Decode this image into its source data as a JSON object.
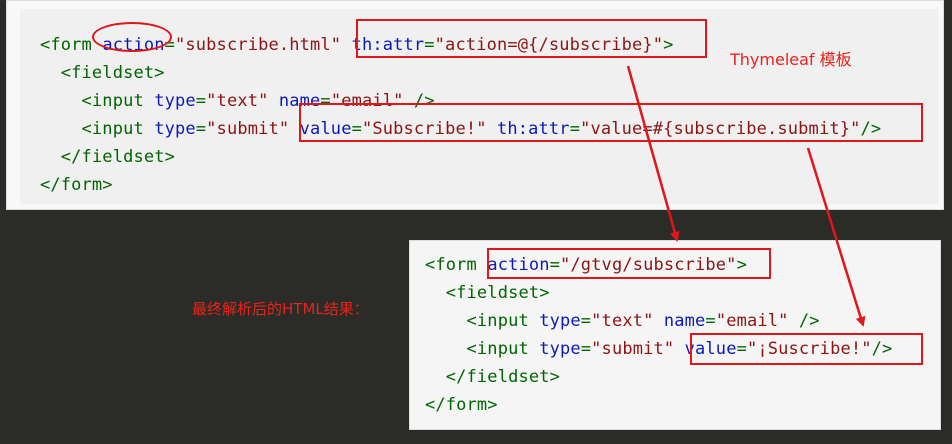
{
  "source_template": {
    "lines": [
      [
        "<form ",
        "action",
        "=",
        "\"subscribe.html\"",
        " ",
        "th:attr",
        "=",
        "\"action=@{/subscribe}\"",
        ">"
      ],
      [
        "  <fieldset>"
      ],
      [
        "    <input ",
        "type",
        "=",
        "\"text\"",
        " ",
        "name",
        "=",
        "\"email\"",
        " />"
      ],
      [
        "    <input ",
        "type",
        "=",
        "\"submit\"",
        " ",
        "value",
        "=",
        "\"Subscribe!\"",
        " ",
        "th:attr",
        "=",
        "\"value=#{subscribe.submit}\"",
        "/>"
      ],
      [
        "  </fieldset>"
      ],
      [
        "</form>"
      ]
    ]
  },
  "result_output": {
    "lines": [
      [
        "<form ",
        "action",
        "=",
        "\"/gtvg/subscribe\"",
        ">"
      ],
      [
        "  <fieldset>"
      ],
      [
        "    <input ",
        "type",
        "=",
        "\"text\"",
        " ",
        "name",
        "=",
        "\"email\"",
        " />"
      ],
      [
        "    <input ",
        "type",
        "=",
        "\"submit\"",
        " ",
        "value",
        "=",
        "\"¡Suscribe!\"",
        "/>"
      ],
      [
        "  </fieldset>"
      ],
      [
        "</form>"
      ]
    ]
  },
  "annotations": {
    "thymeleaf_label": "Thymeleaf  模板",
    "result_label": "最终解析后的HTML结果："
  },
  "colors": {
    "tag": "#006400",
    "attribute": "#0b1ab5",
    "string": "#8b1414",
    "annotation": "#e8231a",
    "background": "#2b2b28"
  }
}
